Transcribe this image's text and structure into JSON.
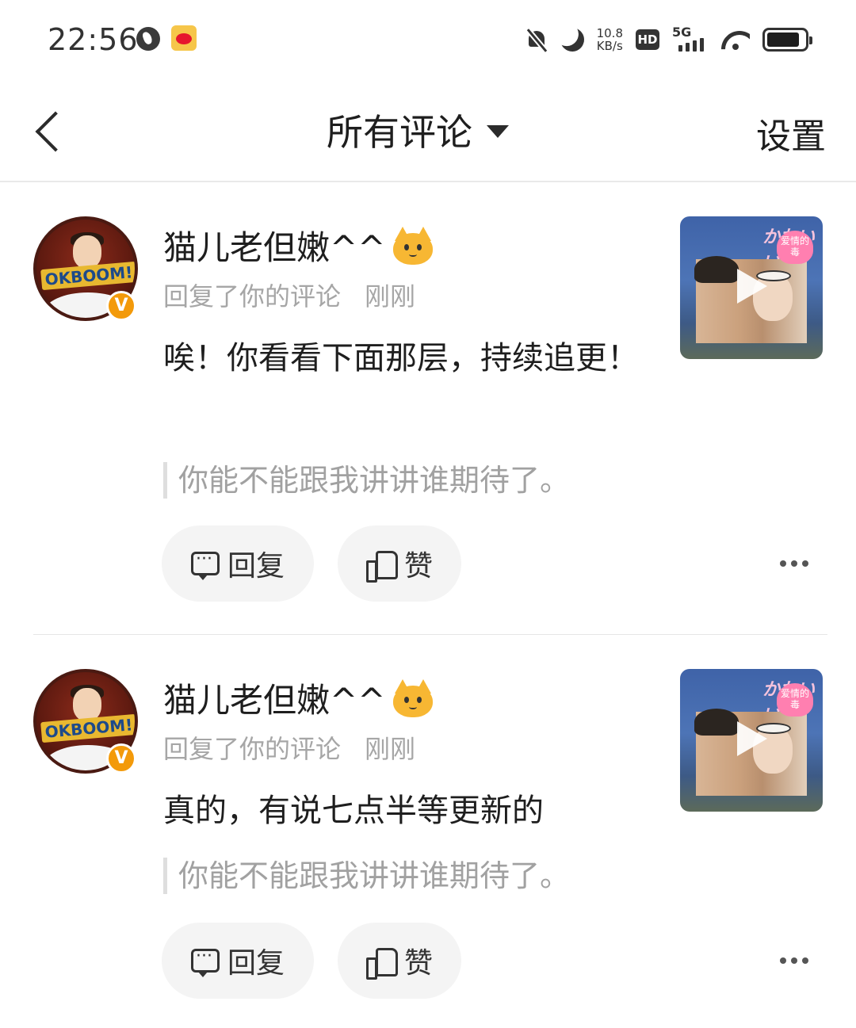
{
  "status_bar": {
    "time": "22:56",
    "net_speed_value": "10.8",
    "net_speed_unit": "KB/s",
    "hd_label": "HD",
    "network_label": "5G",
    "icons": [
      "globe-icon",
      "weibo-icon",
      "mute-bell-icon",
      "moon-icon",
      "hd-icon",
      "signal-icon",
      "wifi-icon",
      "battery-icon"
    ]
  },
  "nav": {
    "title": "所有评论",
    "settings_label": "设置"
  },
  "comments": [
    {
      "username": "猫儿老但嫩^^",
      "action": "回复了你的评论",
      "time": "刚刚",
      "content": "唉！你看看下面那层，持续追更！",
      "quote": "你能不能跟我讲讲谁期待了。",
      "reply_label": "回复",
      "like_label": "赞",
      "thumb_badge": "爱情的毒"
    },
    {
      "username": "猫儿老但嫩^^",
      "action": "回复了你的评论",
      "time": "刚刚",
      "content": "真的，有说七点半等更新的",
      "quote": "你能不能跟我讲讲谁期待了。",
      "reply_label": "回复",
      "like_label": "赞",
      "thumb_badge": "爱情的毒"
    }
  ],
  "avatar_text": "OKBOOM!",
  "verified_badge": "V",
  "thumb_text": "かわいい",
  "colors": {
    "accent_badge": "#f39a0a",
    "text_primary": "#1e1e1e",
    "text_secondary": "#a6a6a6",
    "button_bg": "#f4f4f4"
  }
}
